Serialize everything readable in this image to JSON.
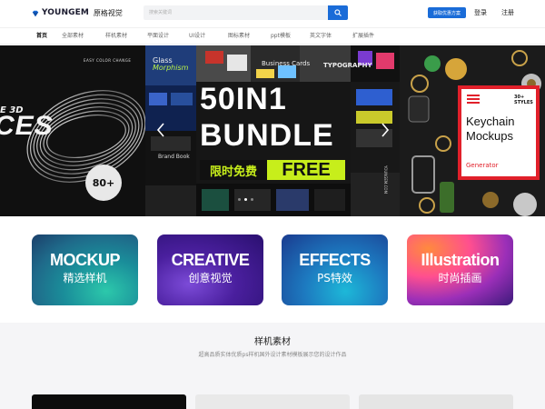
{
  "header": {
    "logo_text": "YOUNGEM",
    "logo_sub": "原格视觉",
    "search": {
      "placeholder": "搜索关键词"
    },
    "vip_button": "获取优惠方案",
    "login": "登录",
    "register": "注册"
  },
  "nav": {
    "items": [
      {
        "label": "首页",
        "active": true
      },
      {
        "label": "全部素材"
      },
      {
        "label": "样机素材"
      },
      {
        "label": "平面设计"
      },
      {
        "label": "UI设计"
      },
      {
        "label": "图标素材"
      },
      {
        "label": "ppt模板"
      },
      {
        "label": "英文字体"
      },
      {
        "label": "扩展插件"
      }
    ]
  },
  "banner": {
    "left": {
      "caption": "EASY COLOR CHANGE",
      "prefix": "E 3D",
      "big_text": "CES",
      "badge": "80+"
    },
    "center": {
      "title_line1": "50IN1",
      "title_line2": "BUNDLE",
      "free_cn": "限时免费",
      "free_en": "FREE",
      "glass_label": "Glass",
      "glass_label2": "Morphism",
      "business_label": "Business Cards",
      "brand_label": "Brand Book",
      "typo_label": "TYPOGRAPHY",
      "side_label": "YOUNGEM.COM"
    },
    "right": {
      "styles_badge": "30+ STYLES",
      "title": "Keychain Mockups",
      "subtitle": "Generator"
    },
    "dots": [
      false,
      true,
      false
    ]
  },
  "categories": [
    {
      "en": "MOCKUP",
      "cn": "精选样机"
    },
    {
      "en": "CREATIVE",
      "cn": "创意视觉"
    },
    {
      "en": "EFFECTS",
      "cn": "PS特效"
    },
    {
      "en": "Illustration",
      "cn": "时尚插画"
    }
  ],
  "section": {
    "title": "样机素材",
    "subtitle": "超高品质实体优质ps样机国外设计素材模板展示您的设计作品"
  },
  "colors": {
    "brand_blue": "#1a6cd8",
    "lime": "#c7ee1b",
    "keychain_red": "#e1202a"
  }
}
